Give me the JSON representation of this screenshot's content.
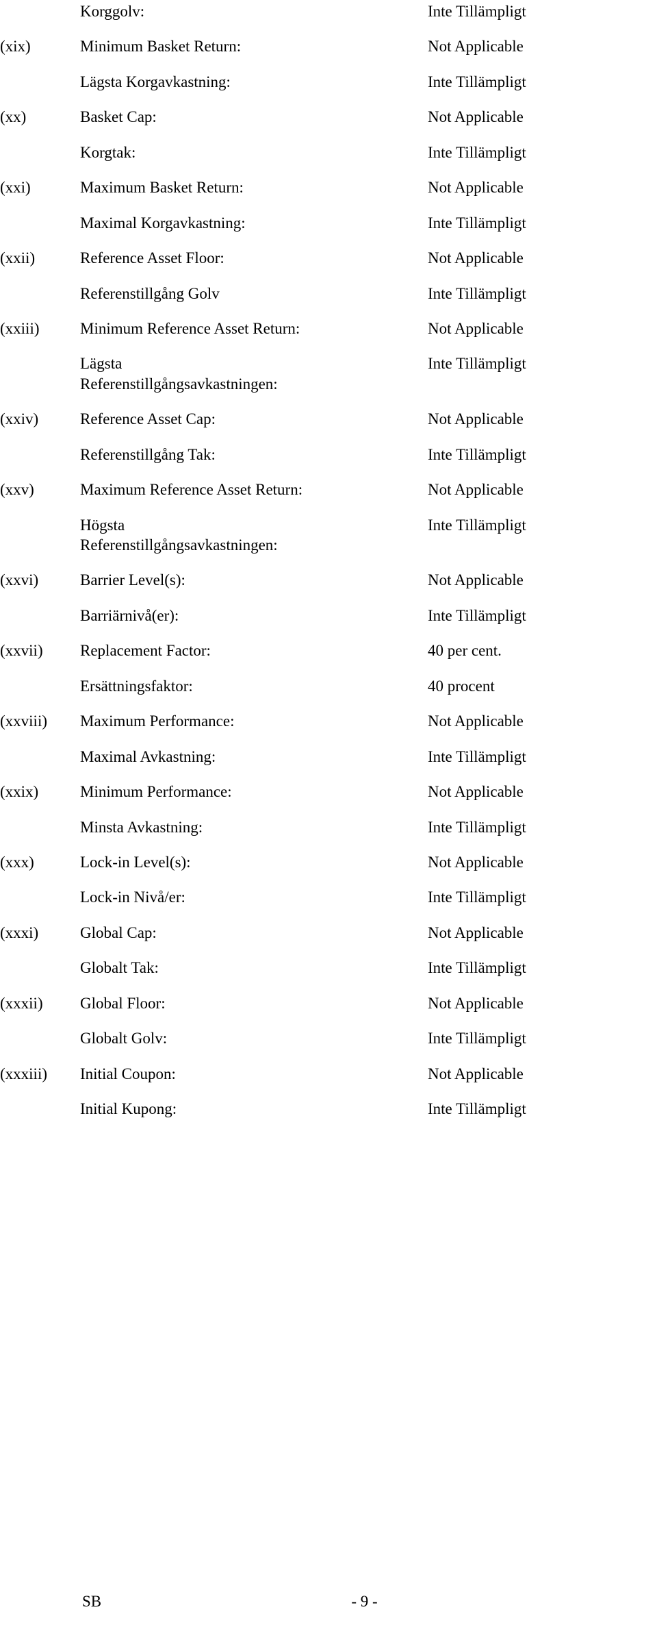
{
  "document": {
    "type": "final-terms-table",
    "language_pairs": "English / Swedish",
    "footer": {
      "left_label": "SB",
      "page_number": "- 9 -"
    }
  },
  "rows": [
    {
      "num": "",
      "label": "Korggolv:",
      "value": "Inte Tillämpligt",
      "lang": "sv"
    },
    {
      "num": "(xix)",
      "label": "Minimum Basket Return:",
      "value": "Not Applicable",
      "lang": "en"
    },
    {
      "num": "",
      "label": "Lägsta Korgavkastning:",
      "value": "Inte Tillämpligt",
      "lang": "sv"
    },
    {
      "num": "(xx)",
      "label": "Basket Cap:",
      "value": "Not Applicable",
      "lang": "en"
    },
    {
      "num": "",
      "label": "Korgtak:",
      "value": "Inte Tillämpligt",
      "lang": "sv"
    },
    {
      "num": "(xxi)",
      "label": "Maximum Basket Return:",
      "value": "Not Applicable",
      "lang": "en"
    },
    {
      "num": "",
      "label": "Maximal Korgavkastning:",
      "value": "Inte Tillämpligt",
      "lang": "sv"
    },
    {
      "num": "(xxii)",
      "label": "Reference Asset Floor:",
      "value": "Not Applicable",
      "lang": "en"
    },
    {
      "num": "",
      "label": "Referenstillgång Golv",
      "value": "Inte Tillämpligt",
      "lang": "sv"
    },
    {
      "num": "(xxiii)",
      "label": "Minimum Reference Asset Return:",
      "value": "Not Applicable",
      "lang": "en"
    },
    {
      "num": "",
      "label": "Lägsta\nReferenstillgångsavkastningen:",
      "value": "Inte Tillämpligt",
      "lang": "sv"
    },
    {
      "num": "(xxiv)",
      "label": "Reference Asset Cap:",
      "value": "Not Applicable",
      "lang": "en"
    },
    {
      "num": "",
      "label": "Referenstillgång Tak:",
      "value": "Inte Tillämpligt",
      "lang": "sv"
    },
    {
      "num": "(xxv)",
      "label": "Maximum Reference Asset Return:",
      "value": "Not Applicable",
      "lang": "en"
    },
    {
      "num": "",
      "label": "Högsta\nReferenstillgångsavkastningen:",
      "value": "Inte Tillämpligt",
      "lang": "sv"
    },
    {
      "num": "(xxvi)",
      "label": "Barrier Level(s):",
      "value": "Not Applicable",
      "lang": "en"
    },
    {
      "num": "",
      "label": "Barriärnivå(er):",
      "value": "Inte Tillämpligt",
      "lang": "sv"
    },
    {
      "num": "(xxvii)",
      "label": "Replacement Factor:",
      "value": "40 per cent.",
      "lang": "en"
    },
    {
      "num": "",
      "label": "Ersättningsfaktor:",
      "value": "40 procent",
      "lang": "sv"
    },
    {
      "num": "(xxviii)",
      "label": "Maximum Performance:",
      "value": "Not Applicable",
      "lang": "en"
    },
    {
      "num": "",
      "label": "Maximal Avkastning:",
      "value": "Inte Tillämpligt",
      "lang": "sv"
    },
    {
      "num": "(xxix)",
      "label": "Minimum Performance:",
      "value": "Not Applicable",
      "lang": "en"
    },
    {
      "num": "",
      "label": "Minsta Avkastning:",
      "value": "Inte Tillämpligt",
      "lang": "sv"
    },
    {
      "num": "(xxx)",
      "label": "Lock-in Level(s):",
      "value": "Not Applicable",
      "lang": "en"
    },
    {
      "num": "",
      "label": "Lock-in Nivå/er:",
      "value": "Inte Tillämpligt",
      "lang": "sv"
    },
    {
      "num": "(xxxi)",
      "label": "Global Cap:",
      "value": "Not Applicable",
      "lang": "en"
    },
    {
      "num": "",
      "label": "Globalt Tak:",
      "value": "Inte Tillämpligt",
      "lang": "sv"
    },
    {
      "num": "(xxxii)",
      "label": "Global Floor:",
      "value": "Not Applicable",
      "lang": "en"
    },
    {
      "num": "",
      "label": "Globalt Golv:",
      "value": "Inte Tillämpligt",
      "lang": "sv"
    },
    {
      "num": "(xxxiii)",
      "label": "Initial Coupon:",
      "value": "Not Applicable",
      "lang": "en"
    },
    {
      "num": "",
      "label": "Initial Kupong:",
      "value": "Inte Tillämpligt",
      "lang": "sv"
    }
  ]
}
